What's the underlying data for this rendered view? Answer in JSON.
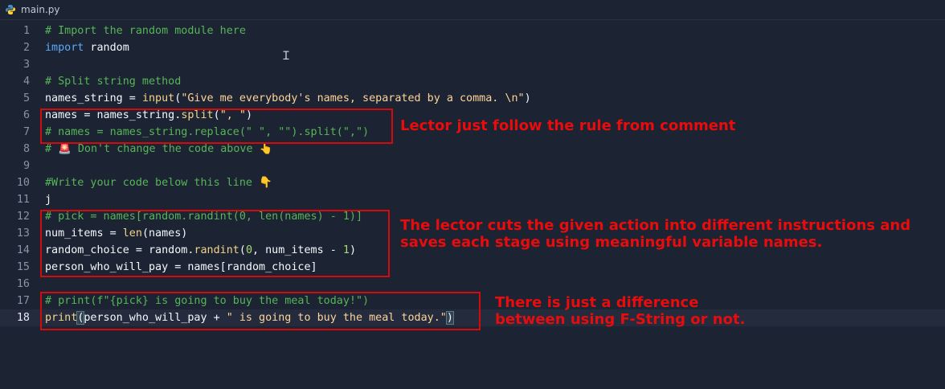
{
  "tab": {
    "filename": "main.py",
    "icon": "python-file-icon"
  },
  "lines": [
    {
      "n": "1",
      "tokens": [
        {
          "t": "# Import the random module here",
          "k": "comment"
        }
      ]
    },
    {
      "n": "2",
      "tokens": [
        {
          "t": "import",
          "k": "kw"
        },
        {
          "t": " random",
          "k": "plain"
        }
      ]
    },
    {
      "n": "3",
      "tokens": []
    },
    {
      "n": "4",
      "tokens": [
        {
          "t": "# Split string method",
          "k": "comment"
        }
      ]
    },
    {
      "n": "5",
      "tokens": [
        {
          "t": "names_string = ",
          "k": "plain"
        },
        {
          "t": "input",
          "k": "fn"
        },
        {
          "t": "(",
          "k": "plain"
        },
        {
          "t": "\"Give me everybody's names, separated by a comma. \\n\"",
          "k": "str"
        },
        {
          "t": ")",
          "k": "plain"
        }
      ]
    },
    {
      "n": "6",
      "tokens": [
        {
          "t": "names = names_string.",
          "k": "plain"
        },
        {
          "t": "split",
          "k": "fn"
        },
        {
          "t": "(",
          "k": "plain"
        },
        {
          "t": "\", \"",
          "k": "str"
        },
        {
          "t": ")",
          "k": "plain"
        }
      ]
    },
    {
      "n": "7",
      "tokens": [
        {
          "t": "# names = names_string.replace(\" \", \"\").split(\",\")",
          "k": "comment"
        }
      ]
    },
    {
      "n": "8",
      "tokens": [
        {
          "t": "# 🚨 Don't change the code above 👆",
          "k": "comment"
        }
      ]
    },
    {
      "n": "9",
      "tokens": []
    },
    {
      "n": "10",
      "tokens": [
        {
          "t": "#Write your code below this line 👇",
          "k": "comment"
        }
      ]
    },
    {
      "n": "11",
      "tokens": [
        {
          "t": "j",
          "k": "plain"
        }
      ]
    },
    {
      "n": "12",
      "tokens": [
        {
          "t": "# pick = names[random.randint(0, len(names) - 1)]",
          "k": "comment"
        }
      ]
    },
    {
      "n": "13",
      "tokens": [
        {
          "t": "num_items = ",
          "k": "plain"
        },
        {
          "t": "len",
          "k": "fn"
        },
        {
          "t": "(names)",
          "k": "plain"
        }
      ]
    },
    {
      "n": "14",
      "tokens": [
        {
          "t": "random_choice = random.",
          "k": "plain"
        },
        {
          "t": "randint",
          "k": "fn"
        },
        {
          "t": "(",
          "k": "plain"
        },
        {
          "t": "0",
          "k": "num"
        },
        {
          "t": ", num_items - ",
          "k": "plain"
        },
        {
          "t": "1",
          "k": "num"
        },
        {
          "t": ")",
          "k": "plain"
        }
      ]
    },
    {
      "n": "15",
      "tokens": [
        {
          "t": "person_who_will_pay = names[random_choice]",
          "k": "plain"
        }
      ]
    },
    {
      "n": "16",
      "tokens": []
    },
    {
      "n": "17",
      "tokens": [
        {
          "t": "# print(f\"{pick} is going to buy the meal today!\")",
          "k": "comment"
        }
      ]
    },
    {
      "n": "18",
      "active": true,
      "tokens": [
        {
          "t": "print",
          "k": "fn"
        },
        {
          "t": "(",
          "k": "bracket"
        },
        {
          "t": "person_who_will_pay + ",
          "k": "plain"
        },
        {
          "t": "\" is going to buy the meal today.\"",
          "k": "str"
        },
        {
          "t": ")",
          "k": "bracket"
        }
      ]
    }
  ],
  "annotations": [
    "Lector just follow the rule from comment",
    "The lector cuts the given action into different instructions and\nsaves each stage using meaningful variable names.",
    "There is just a difference\nbetween using F-String or not."
  ],
  "colors": {
    "background": "#1c2333",
    "comment": "#56b657",
    "keyword": "#5aa9f6",
    "annotation": "#e80c0c"
  }
}
